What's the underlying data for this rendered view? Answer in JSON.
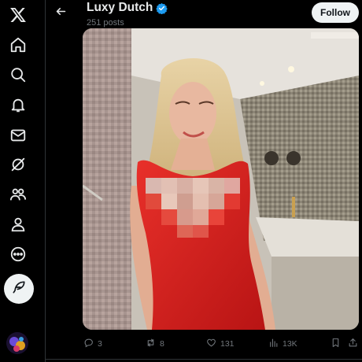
{
  "header": {
    "name": "Luxy Dutch",
    "post_count": "251 posts",
    "follow_label": "Follow"
  },
  "nav": {
    "items": [
      "x-logo-icon",
      "home-icon",
      "search-icon",
      "notifications-icon",
      "messages-icon",
      "grok-icon",
      "communities-icon",
      "profile-icon",
      "more-icon"
    ],
    "compose_icon": "feather-icon"
  },
  "actions": {
    "replies": "3",
    "reposts": "8",
    "likes": "131",
    "views": "13K"
  },
  "colors": {
    "background": "#000000",
    "text": "#e7e9ea",
    "muted": "#71767b",
    "verified": "#1d9bf0",
    "dress": "#d81e1e"
  }
}
